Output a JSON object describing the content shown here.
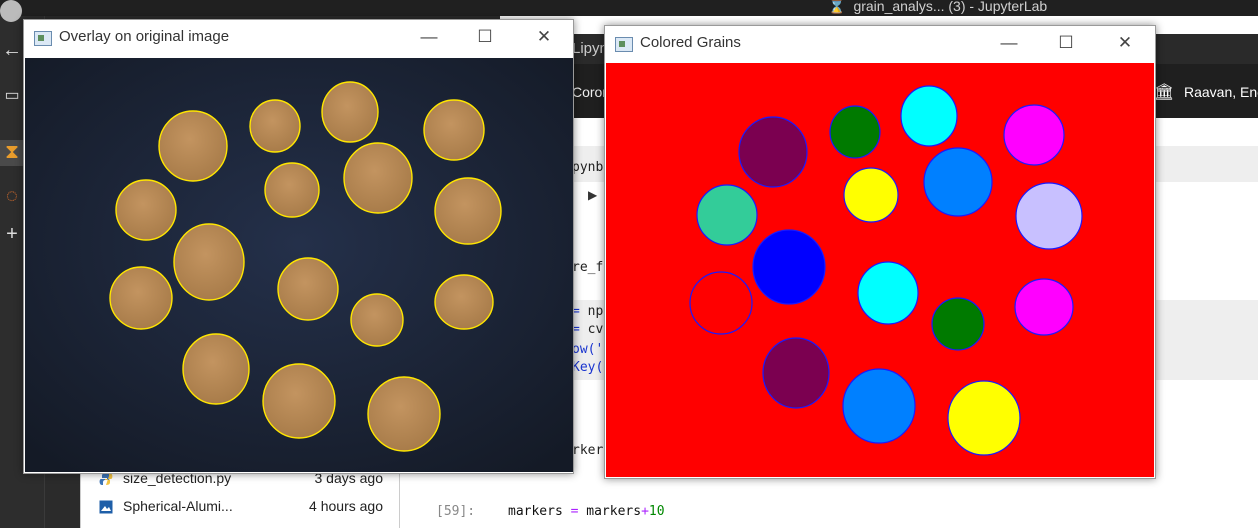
{
  "background": {
    "os_window_title": "grain_analys... (3) - JupyterLab",
    "notebook_tab": "Lipyn",
    "toolbar_left": "Coron",
    "toolbar_right": "Raavan, Ene",
    "filebrowser": [
      {
        "name": "size_detection.py",
        "modified": "3 days ago",
        "icon": "python-file-icon"
      },
      {
        "name": "Spherical-Alumi...",
        "modified": "4 hours ago",
        "icon": "image-file-icon"
      }
    ],
    "cell_prompt": "[59]:",
    "cell_code": {
      "var": "markers",
      "op1": "=",
      "var2": "markers",
      "op2": "+",
      "num": "10"
    },
    "code_fragments": [
      "pynb",
      "re_f",
      "np",
      "cv",
      "ow('",
      "Key(",
      "rker"
    ]
  },
  "overlay_window": {
    "title": "Overlay on original image",
    "controls": {
      "minimize": "—",
      "maximize": "☐",
      "close": "✕"
    },
    "background_color": "#1e2433",
    "grain_fill": "#b58a55",
    "contour_color": "#ffe600"
  },
  "colored_window": {
    "title": "Colored Grains",
    "controls": {
      "minimize": "—",
      "maximize": "☐",
      "close": "✕"
    },
    "background_color": "#ff0000",
    "outline_color": "#1a1aff",
    "grain_colors": [
      "#7b0050",
      "#007a00",
      "#00ffff",
      "#ff00ff",
      "#33cc99",
      "#ffff00",
      "#0080ff",
      "#c8c0ff",
      "#0000ff",
      "#00ffff",
      "#ff0000",
      "#007a00",
      "#ff00ff",
      "#7b0050",
      "#0080ff",
      "#ffff00"
    ]
  }
}
